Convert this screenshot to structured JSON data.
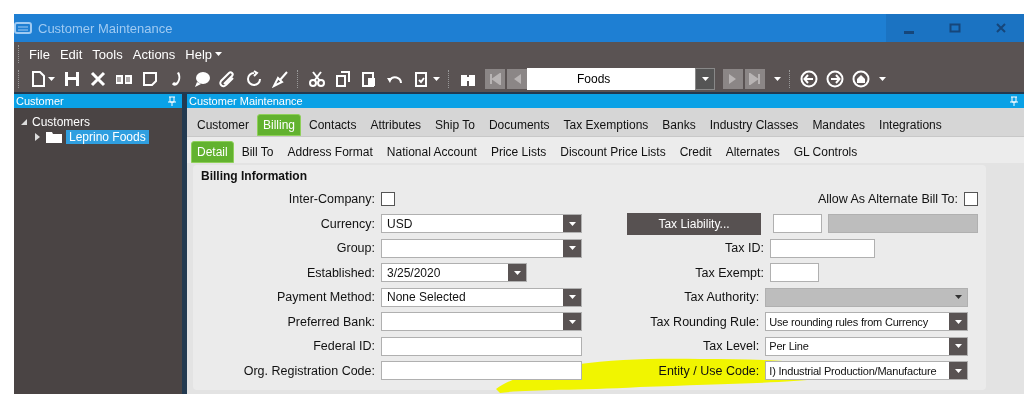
{
  "window": {
    "title": "Customer Maintenance"
  },
  "menu": [
    "File",
    "Edit",
    "Tools",
    "Actions",
    "Help"
  ],
  "toolbar": {
    "record_field": {
      "value": "Foods"
    }
  },
  "sidebar": {
    "title": "Customer",
    "tree": [
      {
        "label": "Customers",
        "expanded": true,
        "children": [
          {
            "label": "Leprino Foods",
            "selected": true
          }
        ]
      }
    ]
  },
  "main": {
    "title": "Customer Maintenance",
    "tabs": [
      {
        "label": "Customer",
        "selected": false
      },
      {
        "label": "Billing",
        "selected": true
      },
      {
        "label": "Contacts",
        "selected": false
      },
      {
        "label": "Attributes",
        "selected": false
      },
      {
        "label": "Ship To",
        "selected": false
      },
      {
        "label": "Documents",
        "selected": false
      },
      {
        "label": "Tax Exemptions",
        "selected": false
      },
      {
        "label": "Banks",
        "selected": false
      },
      {
        "label": "Industry Classes",
        "selected": false
      },
      {
        "label": "Mandates",
        "selected": false
      },
      {
        "label": "Integrations",
        "selected": false
      }
    ],
    "subtabs": [
      {
        "label": "Detail",
        "selected": true
      },
      {
        "label": "Bill To",
        "selected": false
      },
      {
        "label": "Address Format",
        "selected": false
      },
      {
        "label": "National Account",
        "selected": false
      },
      {
        "label": "Price Lists",
        "selected": false
      },
      {
        "label": "Discount Price Lists",
        "selected": false
      },
      {
        "label": "Credit",
        "selected": false
      },
      {
        "label": "Alternates",
        "selected": false
      },
      {
        "label": "GL Controls",
        "selected": false
      }
    ],
    "section_title": "Billing Information",
    "left_fields": [
      {
        "kind": "checkbox",
        "label": "Inter-Company:",
        "checked": false
      },
      {
        "kind": "dropdown",
        "label": "Currency:",
        "value": "USD"
      },
      {
        "kind": "dropdown",
        "label": "Group:"
      },
      {
        "kind": "date",
        "label": "Established:",
        "value": "3/25/2020"
      },
      {
        "kind": "dropdown",
        "label": "Payment Method:",
        "value": "None Selected"
      },
      {
        "kind": "dropdown",
        "label": "Preferred Bank:"
      },
      {
        "kind": "text",
        "label": "Federal ID:"
      },
      {
        "kind": "text",
        "label": "Org. Registration Code:"
      }
    ],
    "right_fields": [
      {
        "kind": "checkbox",
        "label": "Allow As Alternate Bill To:",
        "checked": false
      },
      {
        "kind": "button",
        "label": "Tax Liability..."
      },
      {
        "kind": "text",
        "label": "Tax ID:"
      },
      {
        "kind": "short",
        "label": "Tax Exempt:"
      },
      {
        "kind": "dropdown",
        "label": "Tax Authority:",
        "disabled": true
      },
      {
        "kind": "dropdown",
        "label": "Tax Rounding Rule:",
        "value": "Use rounding rules from Currency"
      },
      {
        "kind": "dropdown",
        "label": "Tax Level:",
        "value": "Per Line"
      },
      {
        "kind": "dropdown",
        "label": "Entity / Use Code:",
        "value": "I) Industrial Production/Manufacture",
        "highlighted": true
      }
    ]
  }
}
